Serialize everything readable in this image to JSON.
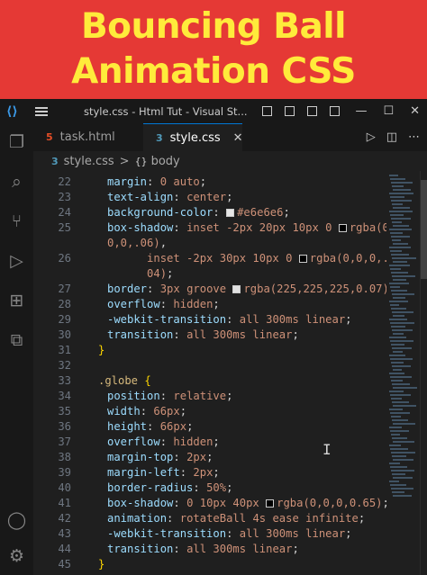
{
  "banner": {
    "line1": "Bouncing Ball",
    "line2": "Animation CSS"
  },
  "window": {
    "title": "style.css - Html Tut - Visual St..."
  },
  "tabs": [
    {
      "label": "task.html",
      "icon": "html5-icon"
    },
    {
      "label": "style.css",
      "icon": "css3-icon"
    }
  ],
  "breadcrumb": {
    "file": "style.css",
    "sep": ">",
    "symbol": "body"
  },
  "code": [
    {
      "n": "22",
      "t": [
        [
          "p",
          "margin"
        ],
        [
          "",
          "‌: "
        ],
        [
          "v",
          "0 auto"
        ],
        [
          "",
          ";"
        ]
      ]
    },
    {
      "n": "23",
      "t": [
        [
          "p",
          "text-align"
        ],
        [
          "",
          ": "
        ],
        [
          "v",
          "center"
        ],
        [
          "",
          ";"
        ]
      ]
    },
    {
      "n": "24",
      "t": [
        [
          "p",
          "background-color"
        ],
        [
          "",
          ": "
        ],
        [
          "sw",
          "#e6e6e6"
        ],
        [
          "v",
          "#e6e6e6"
        ],
        [
          "",
          ";"
        ]
      ]
    },
    {
      "n": "25",
      "t": [
        [
          "p",
          "box-shadow"
        ],
        [
          "",
          ": "
        ],
        [
          "v",
          "inset -2px 20px 10px 0 "
        ],
        [
          "sw",
          "#000000"
        ],
        [
          "v",
          "rgba(0"
        ]
      ]
    },
    {
      "n": "",
      "t": [
        [
          "v",
          "0,0,.06)"
        ],
        [
          "",
          ","
        ]
      ]
    },
    {
      "n": "26",
      "t": [
        [
          "v",
          "      inset -2px 30px 10px 0 "
        ],
        [
          "sw",
          "#000000"
        ],
        [
          "v",
          "rgba(0,0,0,."
        ]
      ]
    },
    {
      "n": "",
      "t": [
        [
          "v",
          "      04)"
        ],
        [
          "",
          ";"
        ]
      ]
    },
    {
      "n": "27",
      "t": [
        [
          "p",
          "border"
        ],
        [
          "",
          ": "
        ],
        [
          "v",
          "3px groove "
        ],
        [
          "sw",
          "#e1e1e1"
        ],
        [
          "v",
          "rgba(225,225,225,0.07)"
        ]
      ]
    },
    {
      "n": "28",
      "t": [
        [
          "p",
          "overflow"
        ],
        [
          "",
          ": "
        ],
        [
          "v",
          "hidden"
        ],
        [
          "",
          ";"
        ]
      ]
    },
    {
      "n": "29",
      "t": [
        [
          "p",
          "-webkit-transition"
        ],
        [
          "",
          ": "
        ],
        [
          "v",
          "all 300ms linear"
        ],
        [
          "",
          ";"
        ]
      ]
    },
    {
      "n": "30",
      "t": [
        [
          "p",
          "transition"
        ],
        [
          "",
          ": "
        ],
        [
          "v",
          "all 300ms linear"
        ],
        [
          "",
          ";"
        ]
      ]
    },
    {
      "n": "31",
      "t": [
        [
          "br",
          "}"
        ]
      ]
    },
    {
      "n": "32",
      "t": []
    },
    {
      "n": "33",
      "t": [
        [
          "sel",
          ".globe "
        ],
        [
          "br",
          "{"
        ]
      ]
    },
    {
      "n": "34",
      "t": [
        [
          "p",
          "position"
        ],
        [
          "",
          ": "
        ],
        [
          "v",
          "relative"
        ],
        [
          "",
          ";"
        ]
      ]
    },
    {
      "n": "35",
      "t": [
        [
          "p",
          "width"
        ],
        [
          "",
          ": "
        ],
        [
          "v",
          "66px"
        ],
        [
          "",
          ";"
        ]
      ]
    },
    {
      "n": "36",
      "t": [
        [
          "p",
          "height"
        ],
        [
          "",
          ": "
        ],
        [
          "v",
          "66px"
        ],
        [
          "",
          ";"
        ]
      ]
    },
    {
      "n": "37",
      "t": [
        [
          "p",
          "overflow"
        ],
        [
          "",
          ": "
        ],
        [
          "v",
          "hidden"
        ],
        [
          "",
          ";"
        ]
      ]
    },
    {
      "n": "38",
      "t": [
        [
          "p",
          "margin-top"
        ],
        [
          "",
          ": "
        ],
        [
          "v",
          "2px"
        ],
        [
          "",
          ";"
        ]
      ]
    },
    {
      "n": "39",
      "t": [
        [
          "p",
          "margin-left"
        ],
        [
          "",
          ": "
        ],
        [
          "v",
          "2px"
        ],
        [
          "",
          ";"
        ]
      ]
    },
    {
      "n": "40",
      "t": [
        [
          "p",
          "border-radius"
        ],
        [
          "",
          ": "
        ],
        [
          "v",
          "50%"
        ],
        [
          "",
          ";"
        ]
      ]
    },
    {
      "n": "41",
      "t": [
        [
          "p",
          "box-shadow"
        ],
        [
          "",
          ": "
        ],
        [
          "v",
          "0 10px 40px "
        ],
        [
          "sw",
          "#000000"
        ],
        [
          "v",
          "rgba(0,0,0,0.65)"
        ],
        [
          "",
          ";"
        ]
      ]
    },
    {
      "n": "42",
      "t": [
        [
          "p",
          "animation"
        ],
        [
          "",
          ": "
        ],
        [
          "v",
          "rotateBall 4s ease infinite"
        ],
        [
          "",
          ";"
        ]
      ]
    },
    {
      "n": "43",
      "t": [
        [
          "p",
          "-webkit-transition"
        ],
        [
          "",
          ": "
        ],
        [
          "v",
          "all 300ms linear"
        ],
        [
          "",
          ";"
        ]
      ]
    },
    {
      "n": "44",
      "t": [
        [
          "p",
          "transition"
        ],
        [
          "",
          ": "
        ],
        [
          "v",
          "all 300ms linear"
        ],
        [
          "",
          ";"
        ]
      ]
    },
    {
      "n": "45",
      "t": [
        [
          "br",
          "}"
        ]
      ]
    }
  ],
  "colors": {
    "banner_bg": "#e53935",
    "banner_text": "#ffeb3b",
    "editor_bg": "#1f1f1f",
    "property": "#9cdcfe",
    "value": "#ce9178",
    "selector": "#d7ba7d"
  }
}
